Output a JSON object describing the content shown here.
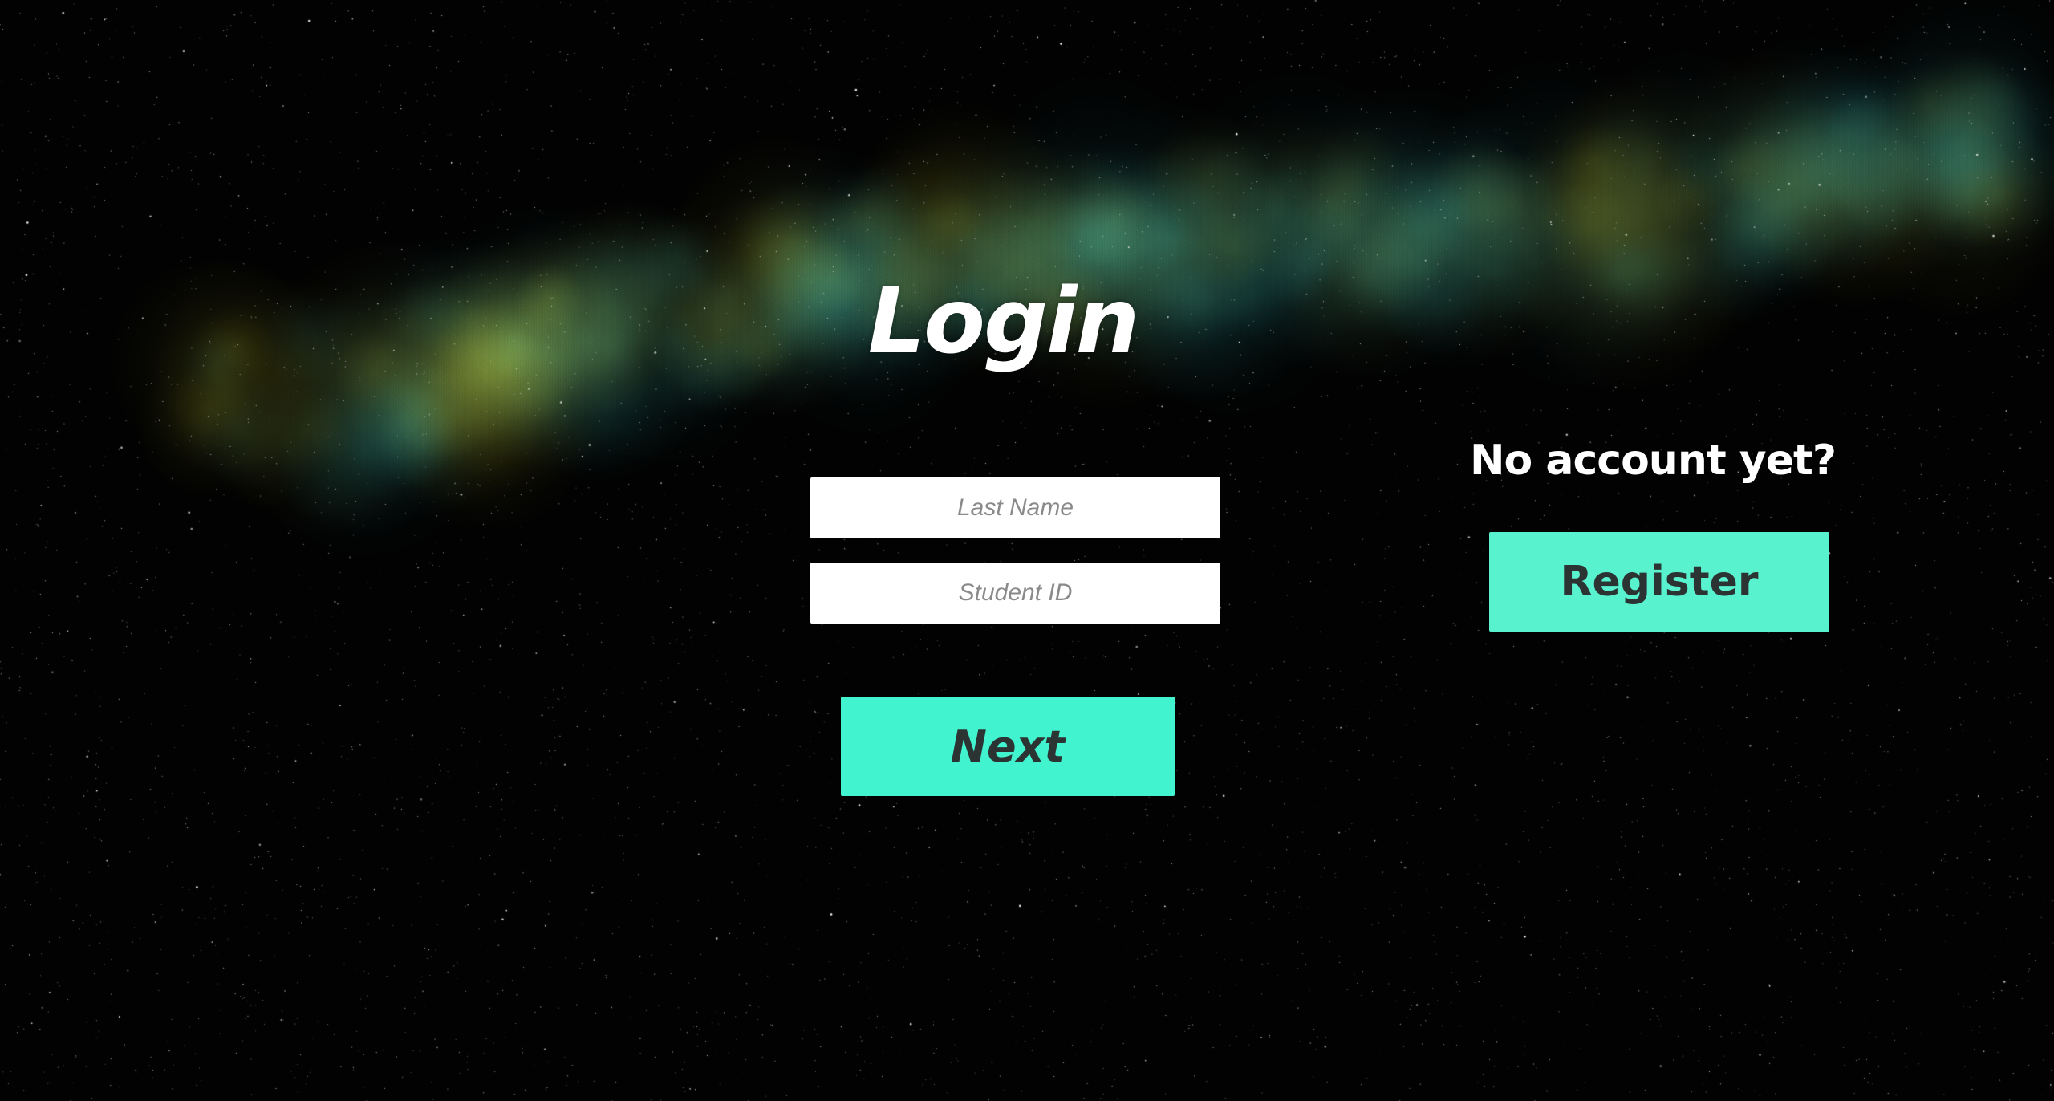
{
  "colors": {
    "background": "#020202",
    "accent": "#42f3cf",
    "register_accent": "#58f2cf",
    "button_text": "#2c3433",
    "title_text": "#ffffff",
    "field_background": "#ffffff",
    "placeholder_text": "#8a8a8a",
    "nebula_teal": "#1e6e6e",
    "nebula_yellow": "#8a8a20"
  },
  "login": {
    "title": "Login",
    "last_name_placeholder": "Last Name",
    "student_id_placeholder": "Student ID",
    "next_label": "Next"
  },
  "signup": {
    "prompt": "No account yet?",
    "register_label": "Register"
  },
  "background": {
    "icon": "starfield-nebula"
  }
}
